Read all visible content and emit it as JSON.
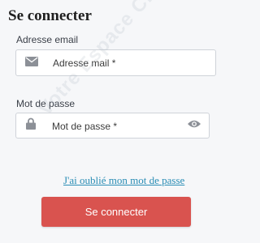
{
  "title": "Se connecter",
  "email": {
    "label": "Adresse email",
    "placeholder": "Adresse mail *",
    "icon": "envelope-icon"
  },
  "password": {
    "label": "Mot de passe",
    "placeholder": "Mot de passe *",
    "lock_icon": "lock-icon",
    "toggle_icon": "eye-icon"
  },
  "forgot_link": "J'ai oublié mon mot de passe",
  "submit_label": "Se connecter",
  "watermark": "Votre Espace Client",
  "colors": {
    "accent": "#d9534f",
    "link": "#2a8db5"
  }
}
